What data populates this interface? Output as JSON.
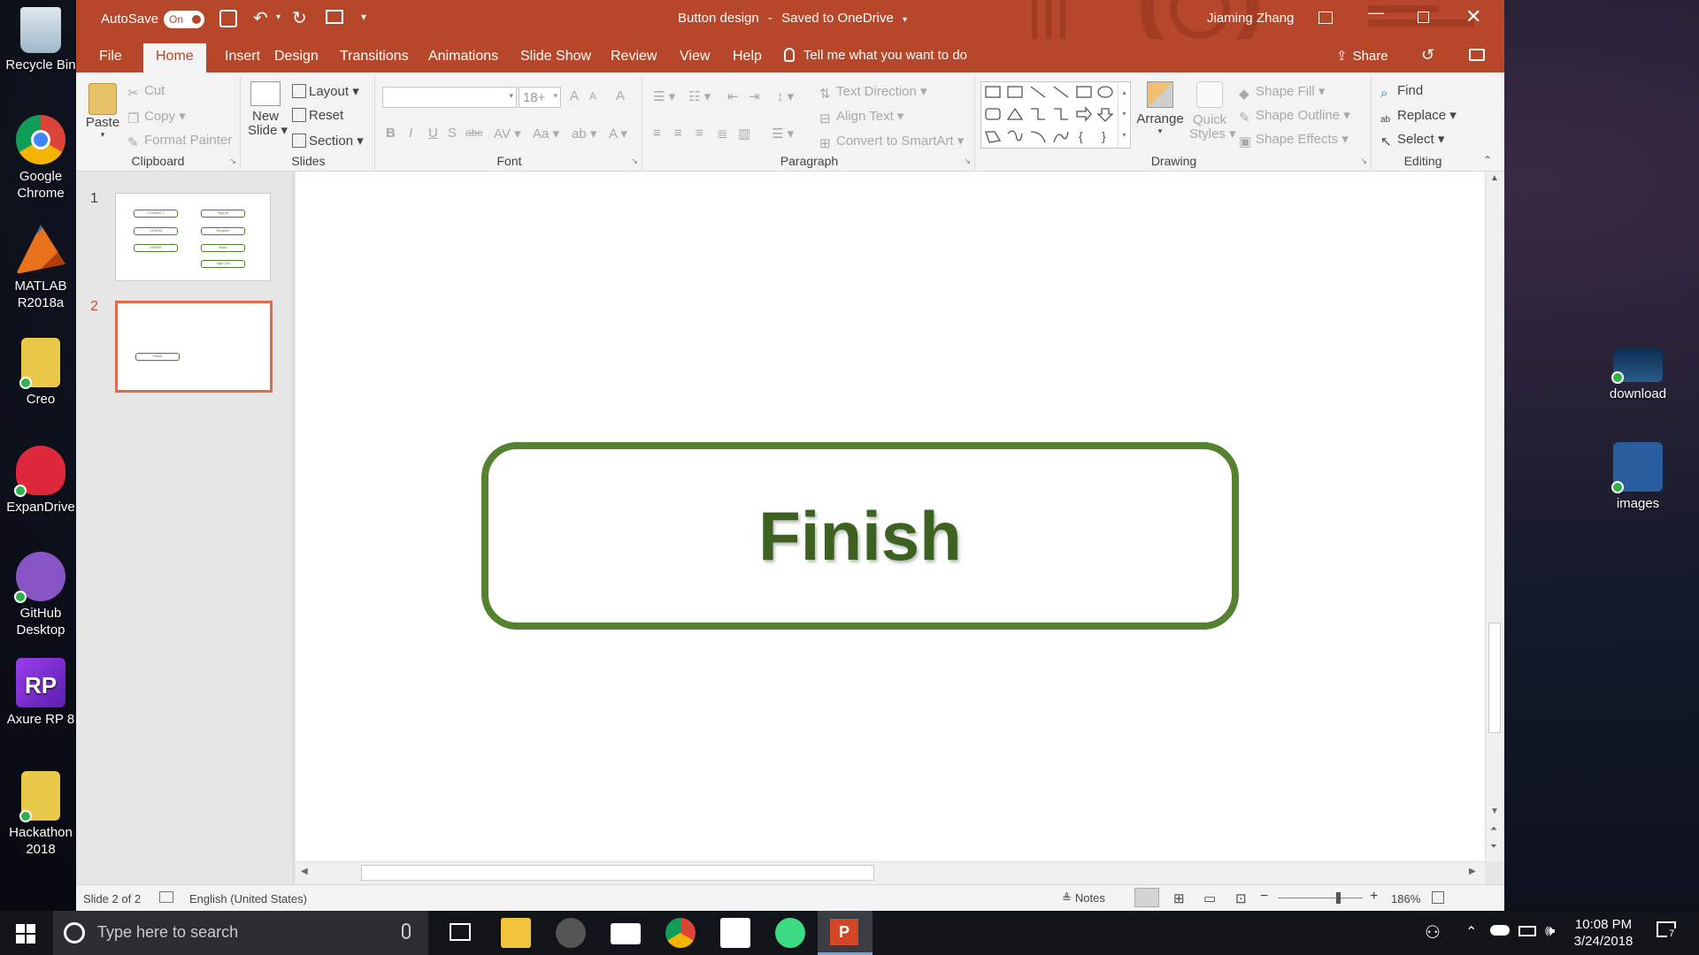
{
  "desktop": {
    "left_icons": [
      {
        "label": "Recycle Bin",
        "color": "#9fb7c9"
      },
      {
        "label": "Google Chrome",
        "color": "#e74c3c"
      },
      {
        "label": "MATLAB R2018a",
        "color": "#e8731c"
      },
      {
        "label": "Creo",
        "color": "#e9c84a"
      },
      {
        "label": "ExpanDrive",
        "color": "#e0283d"
      },
      {
        "label": "GitHub Desktop",
        "color": "#8756c4"
      },
      {
        "label": "Axure RP 8",
        "color": "#7a2fd0"
      },
      {
        "label": "Hackathon 2018",
        "color": "#e9c84a"
      }
    ],
    "right_icons": [
      {
        "label": "download",
        "color": "#2b5c8a"
      },
      {
        "label": "images",
        "color": "#2a5d9e"
      }
    ]
  },
  "titlebar": {
    "autosave_label": "AutoSave",
    "autosave_state": "On",
    "document_title": "Button design",
    "save_status": "Saved to OneDrive",
    "user": "Jiaming Zhang",
    "accent": "#b7472a"
  },
  "tabs": [
    "File",
    "Home",
    "Insert",
    "Design",
    "Transitions",
    "Animations",
    "Slide Show",
    "Review",
    "View",
    "Help"
  ],
  "tell_me": "Tell me what you want to do",
  "share_label": "Share",
  "ribbon": {
    "clipboard": {
      "paste": "Paste",
      "cut": "Cut",
      "copy": "Copy",
      "format_painter": "Format Painter",
      "group": "Clipboard"
    },
    "slides": {
      "new_slide_1": "New",
      "new_slide_2": "Slide",
      "layout": "Layout",
      "reset": "Reset",
      "section": "Section",
      "group": "Slides"
    },
    "font": {
      "font_size": "18+",
      "group": "Font"
    },
    "paragraph": {
      "text_direction": "Text Direction",
      "align_text": "Align Text",
      "convert_smartart": "Convert to SmartArt",
      "group": "Paragraph"
    },
    "drawing": {
      "arrange": "Arrange",
      "quick_styles_1": "Quick",
      "quick_styles_2": "Styles",
      "shape_fill": "Shape Fill",
      "shape_outline": "Shape Outline",
      "shape_effects": "Shape Effects",
      "group": "Drawing"
    },
    "editing": {
      "find": "Find",
      "replace": "Replace",
      "select": "Select",
      "group": "Editing"
    }
  },
  "thumbnails": [
    {
      "number": "1",
      "buttons_left": [
        "CONNECT",
        "LEARN",
        "SHARE"
      ],
      "buttons_right": [
        "Sign In",
        "Register",
        "Back",
        "Sign Out"
      ]
    },
    {
      "number": "2",
      "buttons": [
        "Finish"
      ]
    }
  ],
  "slide": {
    "button_text": "Finish",
    "border_color": "#54822f",
    "text_color": "#3c6121"
  },
  "status": {
    "slide_info": "Slide 2 of 2",
    "language": "English (United States)",
    "notes": "Notes",
    "zoom": "186%"
  },
  "taskbar": {
    "search_placeholder": "Type here to search",
    "time": "10:08 PM",
    "date": "3/24/2018",
    "notification_count": "7"
  }
}
